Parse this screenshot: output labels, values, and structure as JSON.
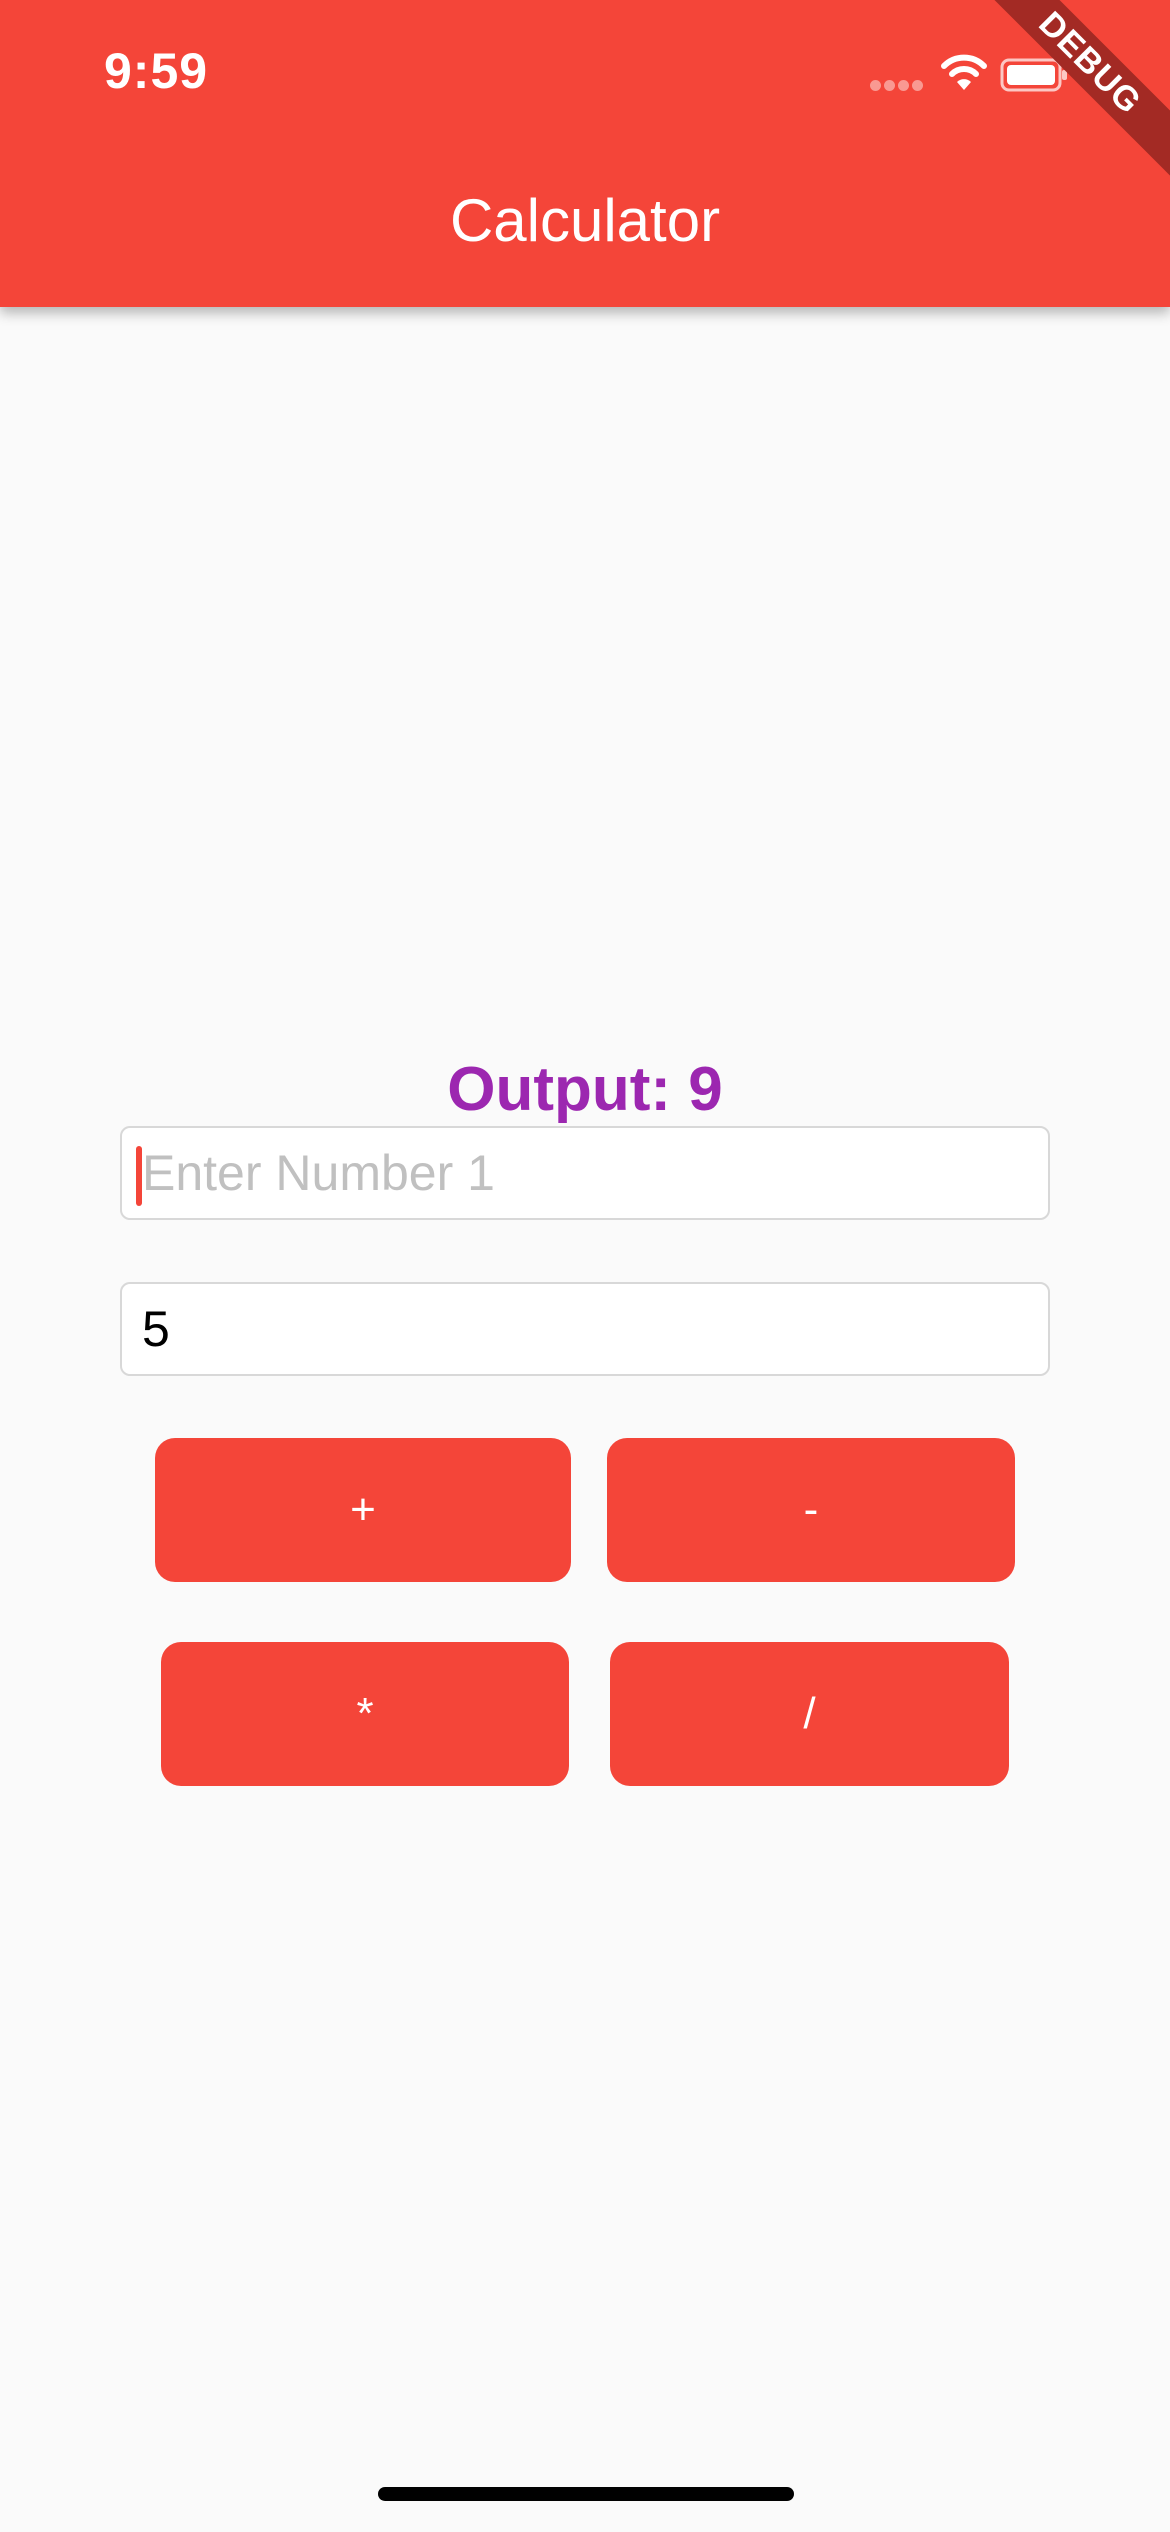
{
  "status_bar": {
    "time": "9:59"
  },
  "app_bar": {
    "title": "Calculator",
    "debug_banner": "DEBUG",
    "color": "#f44539"
  },
  "output": {
    "text": "Output: 9",
    "color": "#9c27b0"
  },
  "inputs": {
    "number1": {
      "placeholder": "Enter Number 1",
      "value": ""
    },
    "number2": {
      "placeholder": "",
      "value": "5"
    }
  },
  "buttons": {
    "add": "+",
    "subtract": "-",
    "multiply": "*",
    "divide": "/"
  },
  "icons": [
    "wifi-icon",
    "battery-icon",
    "signal-icon"
  ]
}
